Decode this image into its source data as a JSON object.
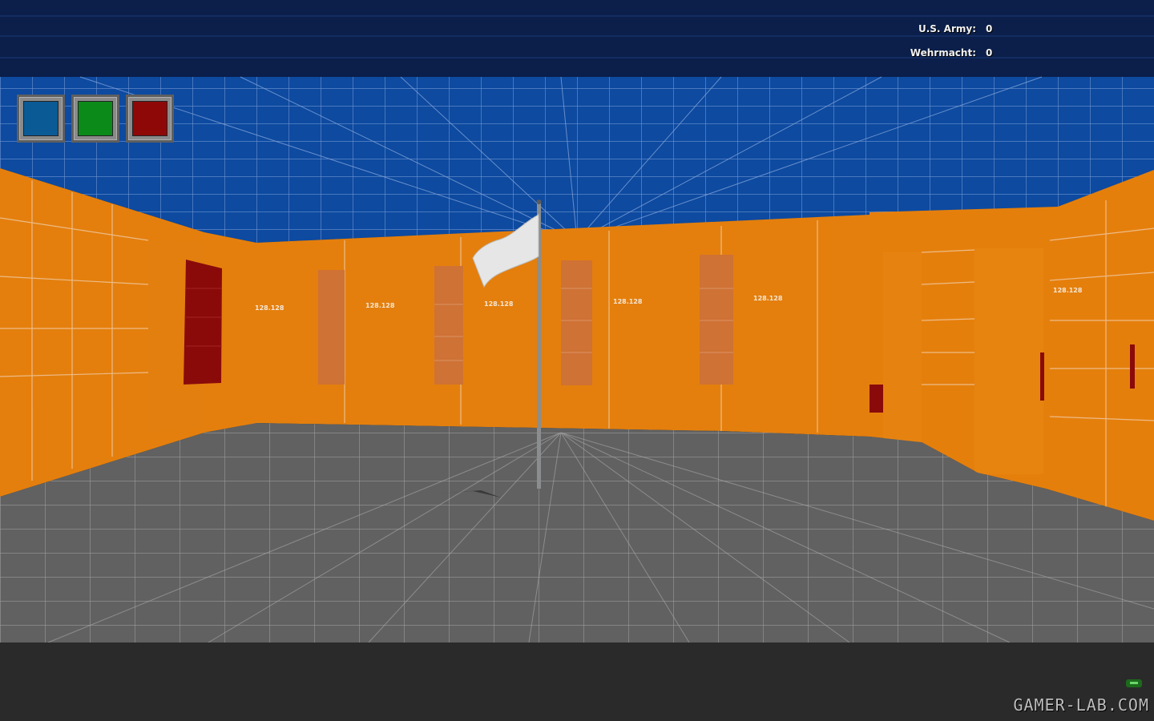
{
  "hud": {
    "scores": [
      {
        "team": "U.S. Army:",
        "value": "0"
      },
      {
        "team": "Wehrmacht:",
        "value": "0"
      }
    ],
    "squads": [
      {
        "name": "blue-squad",
        "color": "#0a5a96"
      },
      {
        "name": "green-squad",
        "color": "#0b8a1a"
      },
      {
        "name": "red-squad",
        "color": "#8e0808"
      }
    ]
  },
  "scene": {
    "flag": {
      "color": "white",
      "state": "neutral"
    },
    "colors": {
      "ceiling": "#0b3f8f",
      "sky_top": "#0b1f4a",
      "walls": "#e47f0d",
      "floor": "#626262",
      "red_panel": "#8a0a0a",
      "grid_line": "#d9e3ee"
    },
    "wall_labels": [
      "128.128",
      "128.128",
      "128.128",
      "128.128",
      "128.128",
      "128.128"
    ]
  },
  "watermark": {
    "text": "GAMER-LAB.COM"
  }
}
